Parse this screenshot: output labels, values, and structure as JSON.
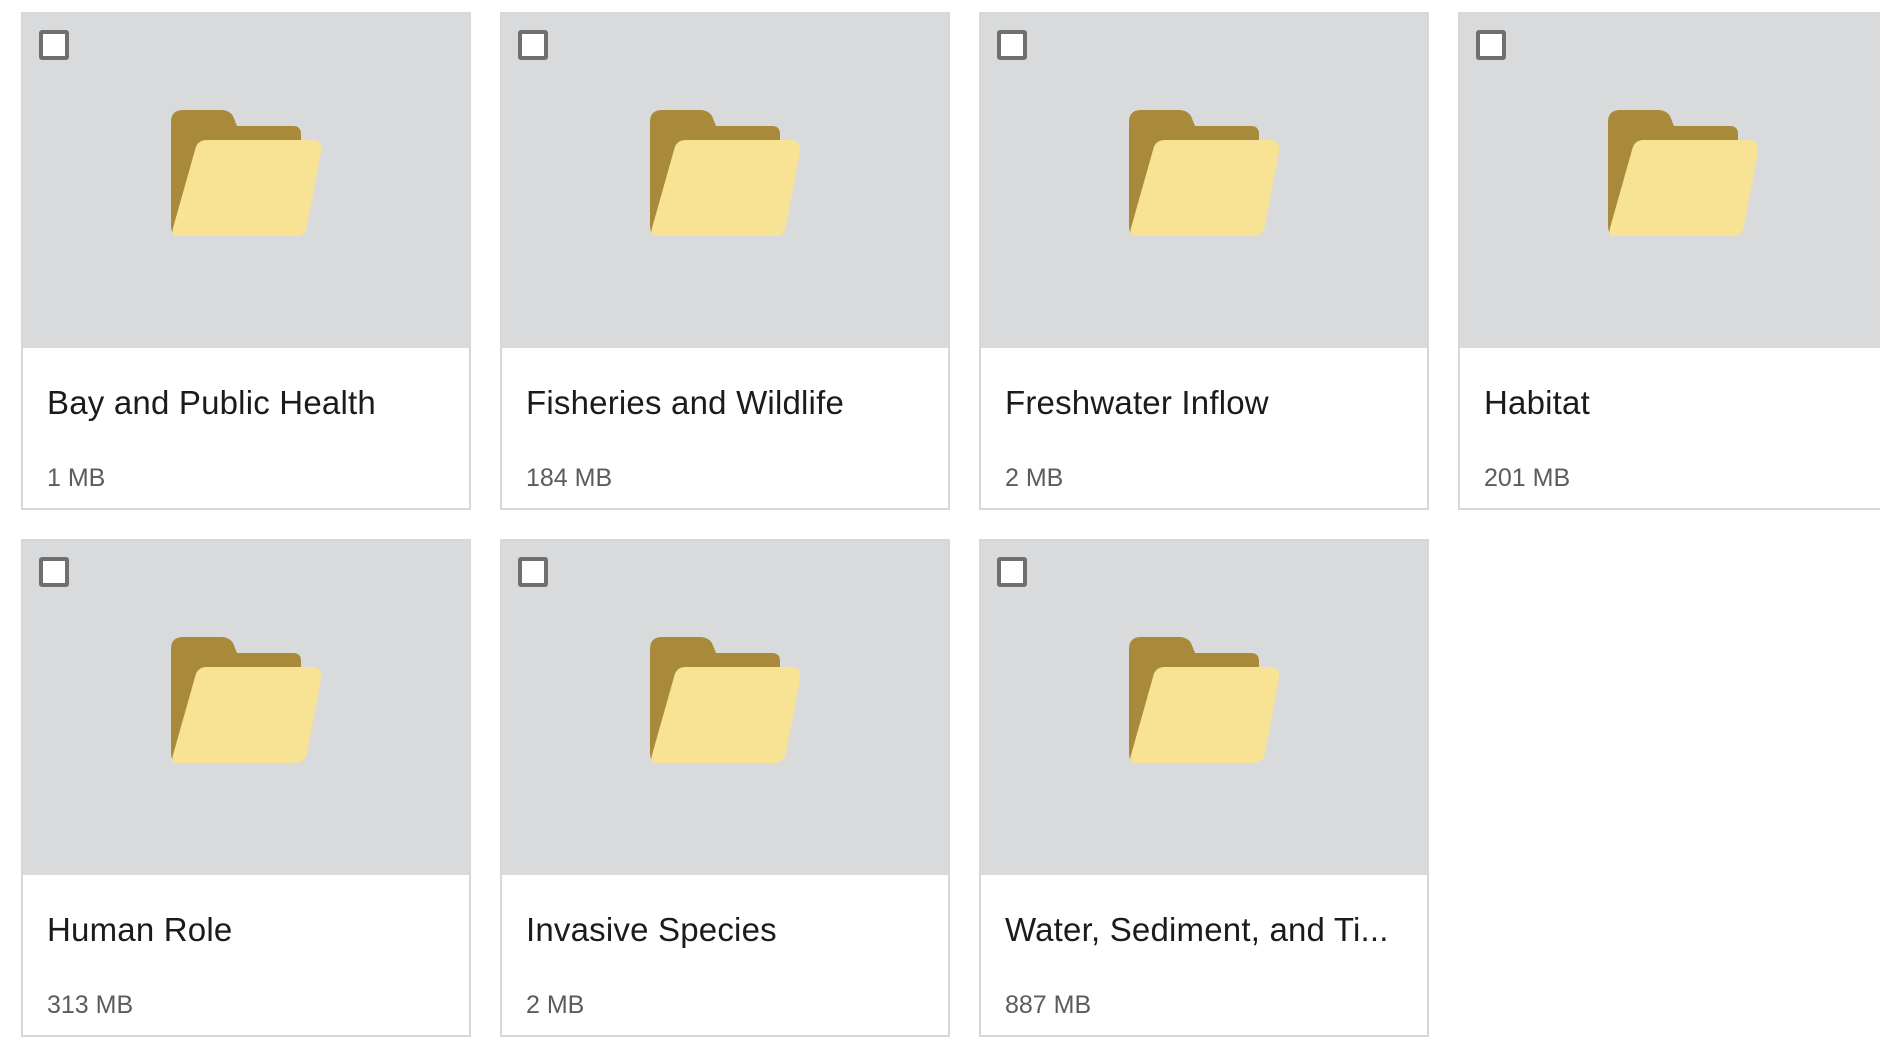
{
  "folders": [
    {
      "name": "Bay and Public Health",
      "size": "1 MB"
    },
    {
      "name": "Fisheries and Wildlife",
      "size": "184 MB"
    },
    {
      "name": "Freshwater Inflow",
      "size": "2 MB"
    },
    {
      "name": "Habitat",
      "size": "201 MB"
    },
    {
      "name": "Human Role",
      "size": "313 MB"
    },
    {
      "name": "Invasive Species",
      "size": "2 MB"
    },
    {
      "name": "Water, Sediment, and Ti...",
      "size": "887 MB"
    }
  ],
  "colors": {
    "thumbnail_bg": "#d9dadc",
    "folder_back": "#a88a3a",
    "folder_front": "#f8e394",
    "card_border": "#d6d7d9"
  },
  "icon": "folder-icon"
}
